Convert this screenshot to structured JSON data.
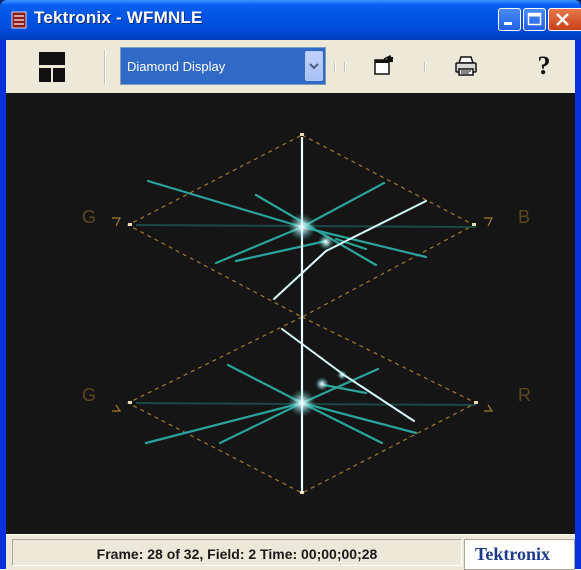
{
  "window": {
    "title": "Tektronix - WFMNLE"
  },
  "toolbar": {
    "layout_icon": "split-layout-icon",
    "display_select": {
      "selected": "Diamond Display"
    },
    "properties_icon": "properties-icon",
    "print_icon": "printer-icon",
    "help_label": "?"
  },
  "display": {
    "labels": {
      "upper_left": "G",
      "upper_right": "B",
      "lower_left": "G",
      "lower_right": "R"
    },
    "colors": {
      "background": "#151515",
      "graticule": "#a07a30",
      "trace": "#2aa39a",
      "trace_bright": "#e8ffff"
    }
  },
  "status": {
    "text": "Frame: 28 of 32,  Field: 2   Time: 00;00;00;28",
    "logo": "Tektronix"
  }
}
